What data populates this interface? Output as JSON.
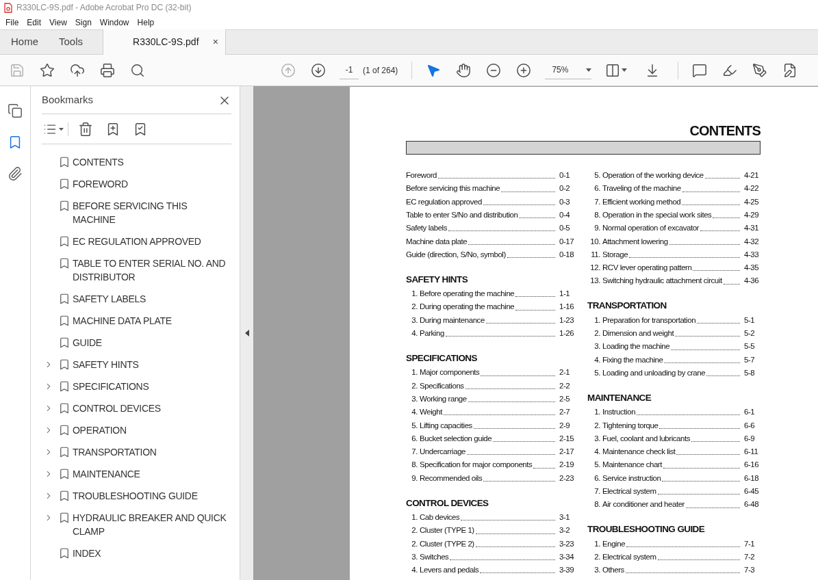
{
  "window": {
    "title": "R330LC-9S.pdf - Adobe Acrobat Pro DC (32-bit)"
  },
  "menu": [
    "File",
    "Edit",
    "View",
    "Sign",
    "Window",
    "Help"
  ],
  "tabs": [
    {
      "label": "Home",
      "selected": false,
      "kind": "nav"
    },
    {
      "label": "Tools",
      "selected": false,
      "kind": "nav"
    },
    {
      "label": "R330LC-9S.pdf",
      "selected": true,
      "kind": "document",
      "close": "×"
    }
  ],
  "toolbar": {
    "page_field": "-1",
    "page_count": "(1 of 264)",
    "zoom": "75%"
  },
  "side_tools": [
    {
      "kind": "pages",
      "selected": false
    },
    {
      "kind": "bookmarks",
      "selected": true
    },
    {
      "kind": "attachments",
      "selected": false
    }
  ],
  "bookmarks": {
    "title": "Bookmarks",
    "items": [
      {
        "label": "CONTENTS",
        "expandable": false
      },
      {
        "label": "FOREWORD",
        "expandable": false
      },
      {
        "label": "BEFORE SERVICING THIS MACHINE",
        "expandable": false
      },
      {
        "label": "EC REGULATION APPROVED",
        "expandable": false
      },
      {
        "label": "TABLE TO ENTER SERIAL NO. AND DISTRIBUTOR",
        "expandable": false
      },
      {
        "label": "SAFETY LABELS",
        "expandable": false
      },
      {
        "label": "MACHINE DATA PLATE",
        "expandable": false
      },
      {
        "label": "GUIDE",
        "expandable": false
      },
      {
        "label": "SAFETY HINTS",
        "expandable": true
      },
      {
        "label": "SPECIFICATIONS",
        "expandable": true
      },
      {
        "label": "CONTROL DEVICES",
        "expandable": true
      },
      {
        "label": "OPERATION",
        "expandable": true
      },
      {
        "label": "TRANSPORTATION",
        "expandable": true
      },
      {
        "label": "MAINTENANCE",
        "expandable": true
      },
      {
        "label": "TROUBLESHOOTING GUIDE",
        "expandable": true
      },
      {
        "label": "HYDRAULIC BREAKER AND QUICK CLAMP",
        "expandable": true
      },
      {
        "label": "INDEX",
        "expandable": false
      }
    ]
  },
  "document": {
    "title": "CONTENTS",
    "columns": [
      [
        {
          "entries": [
            {
              "label": "Foreword",
              "page": "0-1"
            },
            {
              "label": "Before servicing this machine",
              "page": "0-2"
            },
            {
              "label": "EC regulation approved",
              "page": "0-3"
            },
            {
              "label": "Table to enter S/No and distribution",
              "page": "0-4"
            },
            {
              "label": "Safety labels",
              "page": "0-5"
            },
            {
              "label": "Machine data plate",
              "page": "0-17"
            },
            {
              "label": "Guide (direction, S/No, symbol)",
              "page": "0-18"
            }
          ]
        },
        {
          "heading": "SAFETY HINTS",
          "entries": [
            {
              "number": "1.",
              "label": "Before operating the machine",
              "page": "1-1"
            },
            {
              "number": "2.",
              "label": "During operating the machine",
              "page": "1-16"
            },
            {
              "number": "3.",
              "label": "During maintenance",
              "page": "1-23"
            },
            {
              "number": "4.",
              "label": "Parking",
              "page": "1-26"
            }
          ]
        },
        {
          "heading": "SPECIFICATIONS",
          "entries": [
            {
              "number": "1.",
              "label": "Major components",
              "page": "2-1"
            },
            {
              "number": "2.",
              "label": "Specifications",
              "page": "2-2"
            },
            {
              "number": "3.",
              "label": "Working range",
              "page": "2-5"
            },
            {
              "number": "4.",
              "label": "Weight",
              "page": "2-7"
            },
            {
              "number": "5.",
              "label": "Lifting capacities",
              "page": "2-9"
            },
            {
              "number": "6.",
              "label": "Bucket selection guide",
              "page": "2-15"
            },
            {
              "number": "7.",
              "label": "Undercarriage",
              "page": "2-17"
            },
            {
              "number": "8.",
              "label": "Specification for major components",
              "page": "2-19"
            },
            {
              "number": "9.",
              "label": "Recommended oils",
              "page": "2-23"
            }
          ]
        },
        {
          "heading": "CONTROL DEVICES",
          "entries": [
            {
              "number": "1.",
              "label": "Cab devices",
              "page": "3-1"
            },
            {
              "number": "2.",
              "label": "Cluster (TYPE 1)",
              "page": "3-2"
            },
            {
              "number": "2.",
              "label": "Cluster (TYPE 2)",
              "page": "3-23"
            },
            {
              "number": "3.",
              "label": "Switches",
              "page": "3-34"
            },
            {
              "number": "4.",
              "label": "Levers and pedals",
              "page": "3-39"
            }
          ]
        }
      ],
      [
        {
          "entries": [
            {
              "number": "5.",
              "label": "Operation of the working device",
              "page": "4-21"
            },
            {
              "number": "6.",
              "label": "Traveling of the machine",
              "page": "4-22"
            },
            {
              "number": "7.",
              "label": "Efficient working method",
              "page": "4-25"
            },
            {
              "number": "8.",
              "label": "Operation in the special work sites",
              "page": "4-29"
            },
            {
              "number": "9.",
              "label": "Normal operation of excavator",
              "page": "4-31"
            },
            {
              "number": "10.",
              "label": "Attachment lowering",
              "page": "4-32"
            },
            {
              "number": "11.",
              "label": "Storage",
              "page": "4-33"
            },
            {
              "number": "12.",
              "label": "RCV lever operating pattern",
              "page": "4-35"
            },
            {
              "number": "13.",
              "label": "Switching hydraulic attachment circuit",
              "page": "4-36"
            }
          ]
        },
        {
          "heading": "TRANSPORTATION",
          "entries": [
            {
              "number": "1.",
              "label": "Preparation for transportation",
              "page": "5-1"
            },
            {
              "number": "2.",
              "label": "Dimension and weight",
              "page": "5-2"
            },
            {
              "number": "3.",
              "label": "Loading the machine",
              "page": "5-5"
            },
            {
              "number": "4.",
              "label": "Fixing the machine",
              "page": "5-7"
            },
            {
              "number": "5.",
              "label": "Loading and unloading by crane",
              "page": "5-8"
            }
          ]
        },
        {
          "heading": "MAINTENANCE",
          "entries": [
            {
              "number": "1.",
              "label": "Instruction",
              "page": "6-1"
            },
            {
              "number": "2.",
              "label": "Tightening torque",
              "page": "6-6"
            },
            {
              "number": "3.",
              "label": "Fuel, coolant and lubricants",
              "page": "6-9"
            },
            {
              "number": "4.",
              "label": "Maintenance check list",
              "page": "6-11"
            },
            {
              "number": "5.",
              "label": "Maintenance chart",
              "page": "6-16"
            },
            {
              "number": "6.",
              "label": "Service instruction",
              "page": "6-18"
            },
            {
              "number": "7.",
              "label": "Electrical system",
              "page": "6-45"
            },
            {
              "number": "8.",
              "label": "Air conditioner and heater",
              "page": "6-48"
            }
          ]
        },
        {
          "heading": "TROUBLESHOOTING GUIDE",
          "entries": [
            {
              "number": "1.",
              "label": "Engine",
              "page": "7-1"
            },
            {
              "number": "2.",
              "label": "Electrical system",
              "page": "7-2"
            },
            {
              "number": "3.",
              "label": "Others",
              "page": "7-3"
            }
          ]
        }
      ]
    ]
  }
}
